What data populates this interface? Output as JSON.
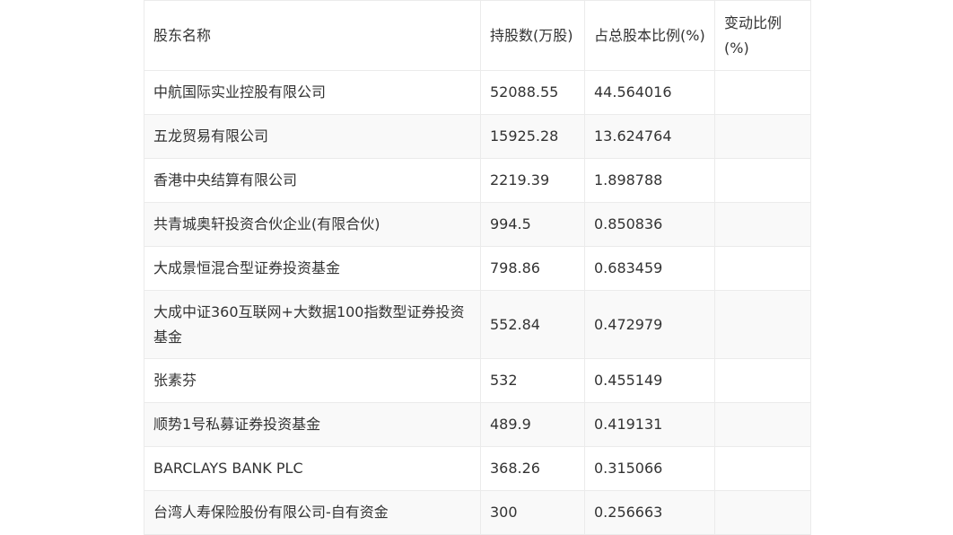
{
  "table": {
    "headers": [
      "股东名称",
      "持股数(万股)",
      "占总股本比例(%)",
      "变动比例(%)"
    ],
    "rows": [
      [
        "中航国际实业控股有限公司",
        "52088.55",
        "44.564016",
        ""
      ],
      [
        "五龙贸易有限公司",
        "15925.28",
        "13.624764",
        ""
      ],
      [
        "香港中央结算有限公司",
        "2219.39",
        "1.898788",
        ""
      ],
      [
        "共青城奥轩投资合伙企业(有限合伙)",
        "994.5",
        "0.850836",
        ""
      ],
      [
        "大成景恒混合型证券投资基金",
        "798.86",
        "0.683459",
        ""
      ],
      [
        "大成中证360互联网+大数据100指数型证券投资基金",
        "552.84",
        "0.472979",
        ""
      ],
      [
        "张素芬",
        "532",
        "0.455149",
        ""
      ],
      [
        "顺势1号私募证券投资基金",
        "489.9",
        "0.419131",
        ""
      ],
      [
        "BARCLAYS BANK PLC",
        "368.26",
        "0.315066",
        ""
      ],
      [
        "台湾人寿保险股份有限公司-自有资金",
        "300",
        "0.256663",
        ""
      ]
    ]
  }
}
